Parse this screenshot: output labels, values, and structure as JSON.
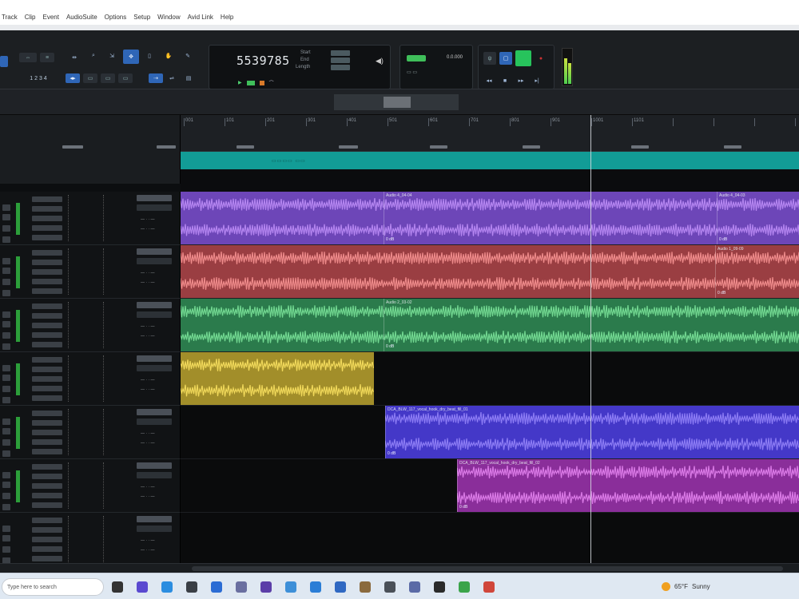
{
  "menubar": {
    "items": [
      "Track",
      "Clip",
      "Event",
      "AudioSuite",
      "Options",
      "Setup",
      "Window",
      "Avid Link",
      "Help"
    ]
  },
  "counter": {
    "main": "5539785",
    "start_label": "Start",
    "end_label": "End",
    "length_label": "Length"
  },
  "tempo": {
    "value": "0.0.000"
  },
  "ruler": {
    "labels": [
      "001",
      "101",
      "201",
      "301",
      "401",
      "501",
      "601",
      "701",
      "801",
      "901",
      "1001",
      "1101"
    ]
  },
  "tracks": [
    {
      "id": "t1",
      "color": "#6d46b8",
      "wave": "#b485f0",
      "clips": [
        {
          "start": 0,
          "end": 254,
          "name": ""
        },
        {
          "start": 254,
          "end": 671,
          "name": "Audio 4_04-04",
          "gain": "0 dB"
        },
        {
          "start": 671,
          "end": 774,
          "name": "Audio 4_04-03",
          "gain": "0 dB"
        }
      ]
    },
    {
      "id": "t2",
      "color": "#9a3e42",
      "wave": "#ee8a8a",
      "clips": [
        {
          "start": 0,
          "end": 669,
          "name": ""
        },
        {
          "start": 669,
          "end": 774,
          "name": "Audio 1_09-09",
          "gain": "0 dB"
        }
      ]
    },
    {
      "id": "t3",
      "color": "#2b7b4c",
      "wave": "#72d891",
      "clips": [
        {
          "start": 0,
          "end": 254,
          "name": ""
        },
        {
          "start": 254,
          "end": 774,
          "name": "Audio 2_03-02",
          "gain": "0 dB"
        }
      ]
    },
    {
      "id": "t4",
      "color": "#a28e2a",
      "wave": "#f0d85a",
      "clips": [
        {
          "start": 0,
          "end": 242,
          "name": ""
        }
      ]
    },
    {
      "id": "t5",
      "color": "#4438c8",
      "wave": "#8b7bf4",
      "clips": [
        {
          "start": 256,
          "end": 774,
          "name": "DCA_BLW_117_vocal_hook_dry_beat_fill_01",
          "gain": "0 dB"
        }
      ]
    },
    {
      "id": "t6",
      "color": "#8a2e9a",
      "wave": "#da7ae6",
      "clips": [
        {
          "start": 346,
          "end": 774,
          "name": "DCA_BLW_117_vocal_hook_dry_beat_fill_02",
          "gain": "0 dB"
        }
      ]
    },
    {
      "id": "t7",
      "color": "#0a0b0c",
      "wave": "#0a0b0c",
      "clips": []
    }
  ],
  "taskbar": {
    "search_placeholder": "Type here to search",
    "weather": "65°F",
    "weather_desc": "Sunny"
  }
}
